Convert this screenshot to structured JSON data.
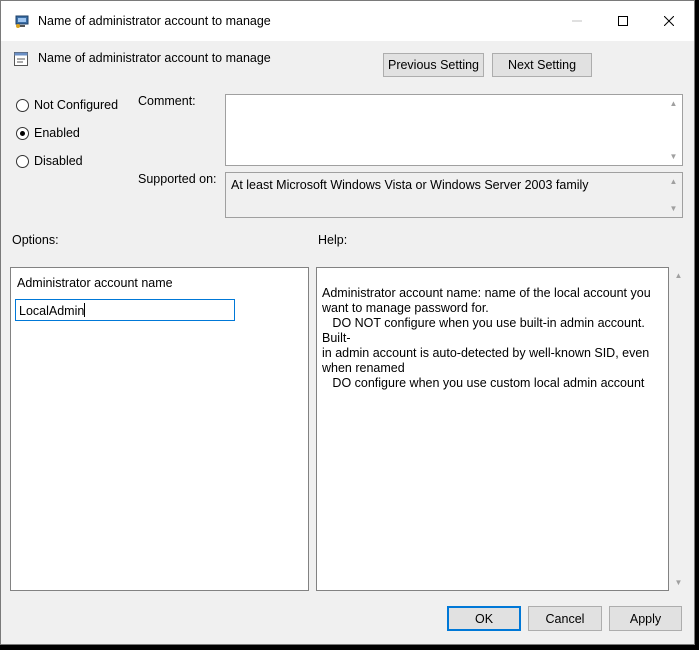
{
  "window": {
    "title": "Name of administrator account to manage",
    "header": "Name of administrator account to manage"
  },
  "nav": {
    "previous_label": "Previous Setting",
    "next_label": "Next Setting"
  },
  "state": {
    "options": [
      {
        "label": "Not Configured",
        "selected": false
      },
      {
        "label": "Enabled",
        "selected": true
      },
      {
        "label": "Disabled",
        "selected": false
      }
    ]
  },
  "comment": {
    "label": "Comment:",
    "value": ""
  },
  "supported": {
    "label": "Supported on:",
    "value": "At least Microsoft Windows Vista or Windows Server 2003 family"
  },
  "options_panel": {
    "heading": "Options:",
    "field_label": "Administrator account name",
    "field_value": "LocalAdmin"
  },
  "help_panel": {
    "heading": "Help:",
    "paragraphs": [
      "Administrator account name: name of the local account you\nwant to manage password for.\n   DO NOT configure when you use built-in admin account. Built-\nin admin account is auto-detected by well-known SID, even\nwhen renamed",
      "   DO configure when you use custom local admin account"
    ]
  },
  "footer": {
    "ok_label": "OK",
    "cancel_label": "Cancel",
    "apply_label": "Apply"
  }
}
